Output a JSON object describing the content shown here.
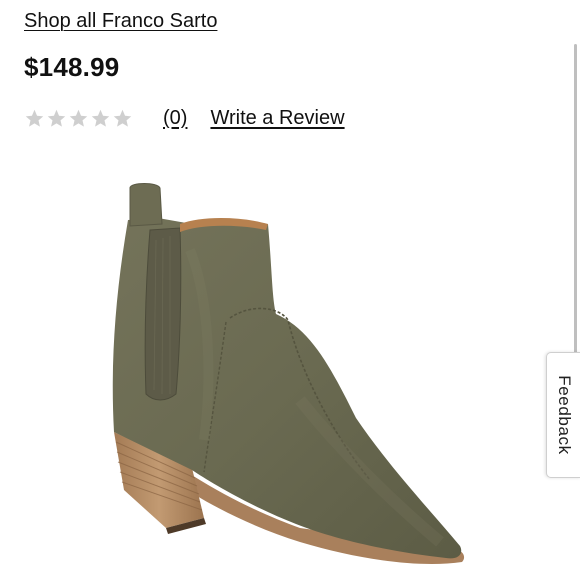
{
  "brand_link": "Shop all Franco Sarto",
  "price": "$148.99",
  "rating": {
    "value": 0,
    "max": 5,
    "count_label": "(0)",
    "write_review_label": "Write a Review"
  },
  "feedback_label": "Feedback",
  "product_image": {
    "icon": "ankle-boot-image"
  },
  "colors": {
    "text": "#111111",
    "star_empty": "#cfcfcf",
    "boot_suede": "#6b6a52",
    "heel_wood": "#b88e66"
  }
}
